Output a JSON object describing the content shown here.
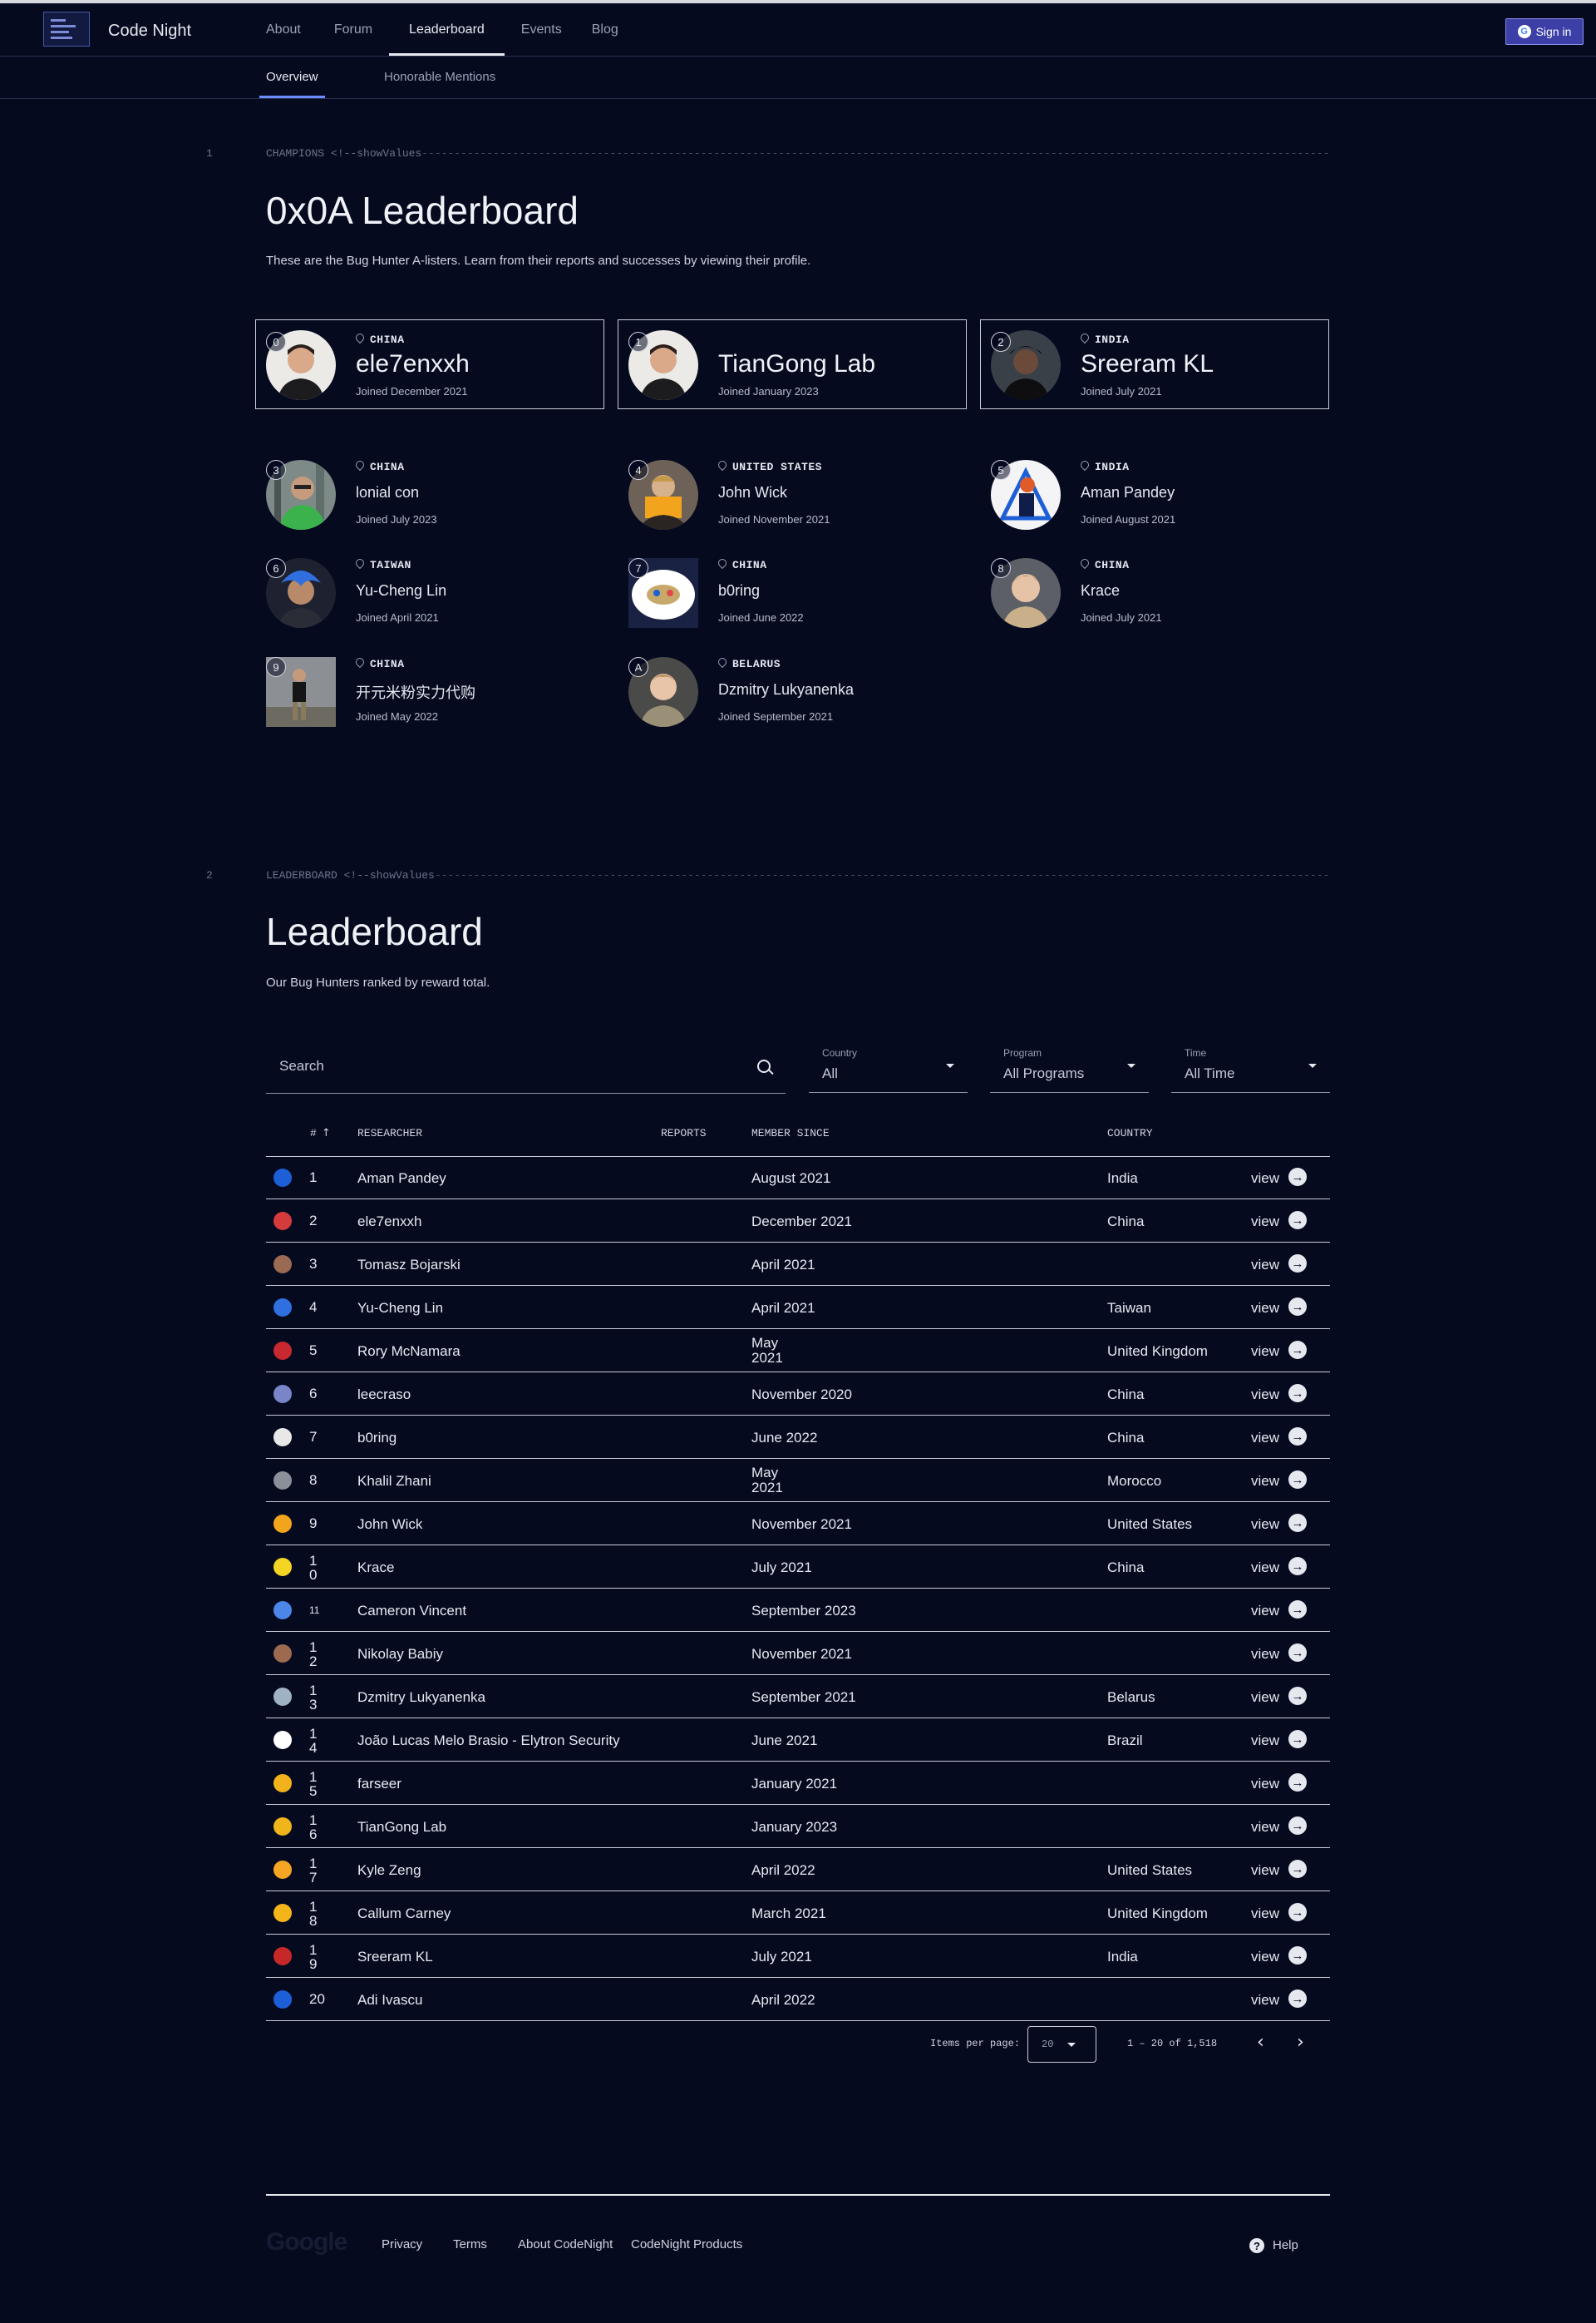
{
  "header": {
    "brand": "Code Night",
    "nav": [
      "About",
      "Forum",
      "Leaderboard",
      "Events",
      "Blog"
    ],
    "active_nav": "Leaderboard",
    "signin_label": "Sign in"
  },
  "subnav": {
    "tabs": [
      "Overview",
      "Honorable Mentions"
    ],
    "active": "Overview"
  },
  "champions_section": {
    "number": "1",
    "label": "CHAMPIONS <!--showValues",
    "title": "0x0A Leaderboard",
    "description": "These are the Bug Hunter A-listers. Learn from their reports and successes by viewing their profile.",
    "top": [
      {
        "rank": "0",
        "country": "CHINA",
        "name": "ele7enxxh",
        "joined": "Joined  December 2021"
      },
      {
        "rank": "1",
        "country": "",
        "name": "TianGong Lab",
        "joined": "Joined  January 2023"
      },
      {
        "rank": "2",
        "country": "INDIA",
        "name": "Sreeram KL",
        "joined": "Joined  July 2021"
      }
    ],
    "others": [
      {
        "rank": "3",
        "country": "CHINA",
        "name": "lonial con",
        "joined": "Joined  July 2023"
      },
      {
        "rank": "4",
        "country": "UNITED STATES",
        "name": "John Wick",
        "joined": "Joined  November 2021"
      },
      {
        "rank": "5",
        "country": "INDIA",
        "name": "Aman Pandey",
        "joined": "Joined  August 2021"
      },
      {
        "rank": "6",
        "country": "TAIWAN",
        "name": "Yu-Cheng Lin",
        "joined": "Joined  April 2021"
      },
      {
        "rank": "7",
        "country": "CHINA",
        "name": "b0ring",
        "joined": "Joined  June 2022"
      },
      {
        "rank": "8",
        "country": "CHINA",
        "name": "Krace",
        "joined": "Joined  July 2021"
      },
      {
        "rank": "9",
        "country": "CHINA",
        "name": "开元米粉实力代购",
        "joined": "Joined  May 2022"
      },
      {
        "rank": "A",
        "country": "BELARUS",
        "name": "Dzmitry Lukyanenka",
        "joined": "Joined  September 2021"
      }
    ]
  },
  "leaderboard_section": {
    "number": "2",
    "label": "LEADERBOARD <!--showValues",
    "title": "Leaderboard",
    "description": "Our Bug Hunters ranked by reward total."
  },
  "filters": {
    "search_placeholder": "Search",
    "country_label": "Country",
    "country_value": "All",
    "program_label": "Program",
    "program_value": "All Programs",
    "time_label": "Time",
    "time_value": "All Time"
  },
  "table": {
    "columns": {
      "rank": "#",
      "researcher": "RESEARCHER",
      "reports": "REPORTS",
      "since": "MEMBER SINCE",
      "country": "COUNTRY"
    },
    "view_label": "view",
    "rows": [
      {
        "rank": "1",
        "name": "Aman Pandey",
        "since": "August 2021",
        "country": "India",
        "icon_color": "#1d5fd6"
      },
      {
        "rank": "2",
        "name": "ele7enxxh",
        "since": "December 2021",
        "country": "China",
        "icon_color": "#d63b3b"
      },
      {
        "rank": "3",
        "name": "Tomasz Bojarski",
        "since": "April 2021",
        "country": "",
        "icon_color": "#9a6a52"
      },
      {
        "rank": "4",
        "name": "Yu-Cheng Lin",
        "since": "April 2021",
        "country": "Taiwan",
        "icon_color": "#2f6fe0"
      },
      {
        "rank": "5",
        "name": "Rory McNamara",
        "since": "May 2021",
        "country": "United Kingdom",
        "icon_color": "#c8282f"
      },
      {
        "rank": "6",
        "name": "leecraso",
        "since": "November 2020",
        "country": "China",
        "icon_color": "#7a84c8"
      },
      {
        "rank": "7",
        "name": "b0ring",
        "since": "June 2022",
        "country": "China",
        "icon_color": "#e8e8e8"
      },
      {
        "rank": "8",
        "name": "Khalil Zhani",
        "since": "May 2021",
        "country": "Morocco",
        "icon_color": "#8b8f99"
      },
      {
        "rank": "9",
        "name": "John Wick",
        "since": "November 2021",
        "country": "United States",
        "icon_color": "#f2a51c"
      },
      {
        "rank": "10",
        "name": "Krace",
        "since": "July 2021",
        "country": "China",
        "icon_color": "#f5d523"
      },
      {
        "rank": "11",
        "name": "Cameron Vincent",
        "since": "September 2023",
        "country": "",
        "icon_color": "#4b86e8"
      },
      {
        "rank": "12",
        "name": "Nikolay Babiy",
        "since": "November 2021",
        "country": "",
        "icon_color": "#9c6b4f"
      },
      {
        "rank": "13",
        "name": "Dzmitry Lukyanenka",
        "since": "September 2021",
        "country": "Belarus",
        "icon_color": "#9fb2c4"
      },
      {
        "rank": "14",
        "name": "João Lucas Melo Brasio - Elytron Security",
        "since": "June 2021",
        "country": "Brazil",
        "icon_color": "#ffffff"
      },
      {
        "rank": "15",
        "name": "farseer",
        "since": "January 2021",
        "country": "",
        "icon_color": "#f2b21c"
      },
      {
        "rank": "16",
        "name": "TianGong Lab",
        "since": "January 2023",
        "country": "",
        "icon_color": "#f0b51a"
      },
      {
        "rank": "17",
        "name": "Kyle Zeng",
        "since": "April 2022",
        "country": "United States",
        "icon_color": "#f5a623"
      },
      {
        "rank": "18",
        "name": "Callum Carney",
        "since": "March 2021",
        "country": "United Kingdom",
        "icon_color": "#f5b51a"
      },
      {
        "rank": "19",
        "name": "Sreeram KL",
        "since": "July 2021",
        "country": "India",
        "icon_color": "#c62828"
      },
      {
        "rank": "20",
        "name": "Adi Ivascu",
        "since": "April 2022",
        "country": "",
        "icon_color": "#1d5fd6"
      }
    ]
  },
  "pagination": {
    "items_per_page_label": "Items per page:",
    "items_per_page": "20",
    "range": "1 – 20 of 1,518"
  },
  "footer": {
    "logo": "Google",
    "links": [
      "Privacy",
      "Terms",
      "About CodeNight",
      "CodeNight Products"
    ],
    "help": "Help"
  }
}
